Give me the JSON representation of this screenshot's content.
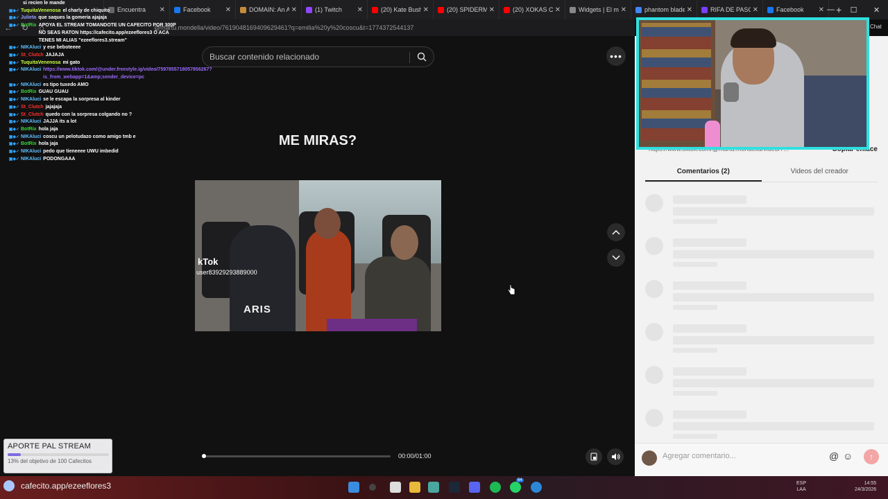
{
  "browser": {
    "tabs": [
      {
        "label": "Encuentra",
        "color": "#666666"
      },
      {
        "label": "Facebook",
        "color": "#1877f2"
      },
      {
        "label": "DOMAIN: An AI",
        "color": "#c58b3b"
      },
      {
        "label": "(1) Twitch",
        "color": "#9146ff"
      },
      {
        "label": "(20) Kate Bush",
        "color": "#ff0000"
      },
      {
        "label": "(20) SPIDERMAN",
        "color": "#ff0000"
      },
      {
        "label": "(20) XOKAS CR",
        "color": "#ff0000"
      },
      {
        "label": "Widgets | El m",
        "color": "#888888"
      },
      {
        "label": "phantom blade",
        "color": "#4285f4"
      },
      {
        "label": "RIFA DE PASCU",
        "color": "#7a3fff"
      },
      {
        "label": "Facebook",
        "color": "#1877f2"
      }
    ],
    "url": "@martu.mondella/video/7619048169409629461?q=emilia%20y%20coscu&t=1774372544137",
    "new_tab": "+"
  },
  "search": {
    "placeholder": "Buscar contenido relacionado"
  },
  "video": {
    "caption": "ME MIRAS?",
    "watermark_logo": "kTok",
    "watermark_user": "user83929293889000",
    "overlay_text": "ARIS",
    "time": "00:00/01:00",
    "progress": 0
  },
  "chat": {
    "messages": [
      {
        "user": "",
        "text": "si recien le mande",
        "cls": "u-nik"
      },
      {
        "user": "TuquitaVenenosa",
        "text": "el charly de chiquito",
        "cls": "u-tuq"
      },
      {
        "user": "Julieta",
        "text": "que saques la gomeria ajajaja",
        "cls": "u-jul"
      },
      {
        "user": "BotRix",
        "text": "APOYA EL STREAM TOMANDOTE UN CAFECITO POR 300P NO SEAS RATON https://cafecito.app/ezeeflores3 O ACA TENES MI ALIAS \"ezeeflores3.stream\"",
        "cls": "u-bot"
      },
      {
        "user": "NIKAluci",
        "text": "y ese beboteeee",
        "cls": "u-nik"
      },
      {
        "user": "St_Clutch",
        "text": "JAJAJA",
        "cls": "u-clutch"
      },
      {
        "user": "TuquitaVenenosa",
        "text": "mi gato",
        "cls": "u-tuq"
      },
      {
        "user": "NIKAluci",
        "text": "https://www.tiktok.com/@under.freestyle.ig/video/7597855718057856267?is_from_webapp=1&amp;sender_device=pc",
        "cls": "u-nik",
        "link": true
      },
      {
        "user": "NIKAluci",
        "text": "es tipo tuxedo AMO",
        "cls": "u-nik"
      },
      {
        "user": "BotRix",
        "text": "GUAU GUAU",
        "cls": "u-bot"
      },
      {
        "user": "NIKAluci",
        "text": "se le escapa la sorpresa al kinder",
        "cls": "u-nik"
      },
      {
        "user": "St_Clutch",
        "text": "jajajaja",
        "cls": "u-clutch"
      },
      {
        "user": "St_Clutch",
        "text": "quedo con la sorpresa colgando no ?",
        "cls": "u-clutch"
      },
      {
        "user": "NIKAluci",
        "text": "JAJJA its a lot",
        "cls": "u-nik"
      },
      {
        "user": "BotRix",
        "text": "hola jaja",
        "cls": "u-bot"
      },
      {
        "user": "NIKAluci",
        "text": "coscu un pelotudazo como amigo tmb e",
        "cls": "u-nik"
      },
      {
        "user": "BotRix",
        "text": "hola jaja",
        "cls": "u-bot"
      },
      {
        "user": "NIKAluci",
        "text": "pedo que tieneeee UWU imbedid",
        "cls": "u-nik"
      },
      {
        "user": "NIKAluci",
        "text": "PODONGAAA",
        "cls": "u-nik"
      }
    ]
  },
  "panel": {
    "link_text": "https://www.tiktok.com/@martu.mondella/video/7...",
    "copy_link": "Copiar enlace",
    "tab_comments": "Comentarios (2)",
    "tab_creator": "Videos del creador",
    "comment_placeholder": "Agregar comentario...",
    "skeleton_rows": 6
  },
  "webcam": {
    "chat_label": "Chat"
  },
  "donation": {
    "title": "APORTE PAL STREAM",
    "subtitle": "13% del objetivo de 100 Cafecitos",
    "progress_percent": 13
  },
  "taskbar": {
    "pill_text": "cafecito.app/ezeeflores3",
    "lang_line1": "ESP",
    "lang_line2": "LAA",
    "clock_time": "14:55",
    "clock_date": "24/3/2026",
    "notif_badge": "64"
  },
  "colors": {
    "webcam_border": "#2fe0e0",
    "accent_purple": "#7b6be0"
  }
}
